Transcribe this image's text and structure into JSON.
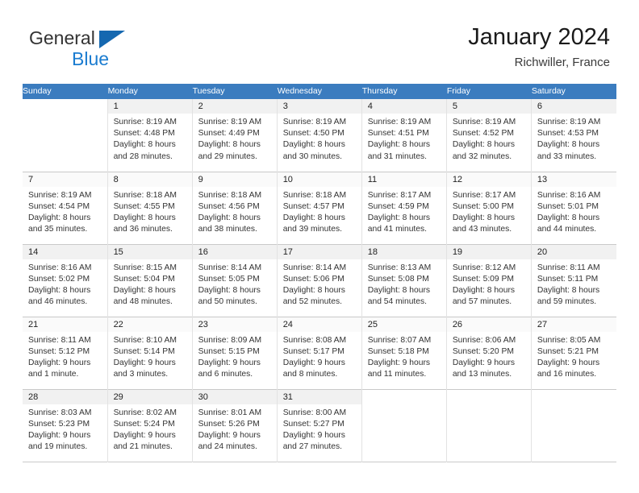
{
  "brand": {
    "word_top": "General",
    "word_bottom": "Blue",
    "triangle_color": "#1568b0",
    "blue_color": "#1b7cd0"
  },
  "header": {
    "title": "January 2024",
    "subtitle": "Richwiller, France"
  },
  "theme": {
    "header_row_background": "#3b7cbf",
    "header_row_text": "#ffffff",
    "daynum_band": "#f1f1f1",
    "grid_line": "#c9c9c9"
  },
  "calendar": {
    "weekday_headers": [
      "Sunday",
      "Monday",
      "Tuesday",
      "Wednesday",
      "Thursday",
      "Friday",
      "Saturday"
    ],
    "labels": {
      "sunrise": "Sunrise:",
      "sunset": "Sunset:",
      "daylight": "Daylight:"
    },
    "weeks": [
      [
        {
          "day": "",
          "lines": []
        },
        {
          "day": "1",
          "lines": [
            "Sunrise: 8:19 AM",
            "Sunset: 4:48 PM",
            "Daylight: 8 hours",
            "and 28 minutes."
          ]
        },
        {
          "day": "2",
          "lines": [
            "Sunrise: 8:19 AM",
            "Sunset: 4:49 PM",
            "Daylight: 8 hours",
            "and 29 minutes."
          ]
        },
        {
          "day": "3",
          "lines": [
            "Sunrise: 8:19 AM",
            "Sunset: 4:50 PM",
            "Daylight: 8 hours",
            "and 30 minutes."
          ]
        },
        {
          "day": "4",
          "lines": [
            "Sunrise: 8:19 AM",
            "Sunset: 4:51 PM",
            "Daylight: 8 hours",
            "and 31 minutes."
          ]
        },
        {
          "day": "5",
          "lines": [
            "Sunrise: 8:19 AM",
            "Sunset: 4:52 PM",
            "Daylight: 8 hours",
            "and 32 minutes."
          ]
        },
        {
          "day": "6",
          "lines": [
            "Sunrise: 8:19 AM",
            "Sunset: 4:53 PM",
            "Daylight: 8 hours",
            "and 33 minutes."
          ]
        }
      ],
      [
        {
          "day": "7",
          "lines": [
            "Sunrise: 8:19 AM",
            "Sunset: 4:54 PM",
            "Daylight: 8 hours",
            "and 35 minutes."
          ]
        },
        {
          "day": "8",
          "lines": [
            "Sunrise: 8:18 AM",
            "Sunset: 4:55 PM",
            "Daylight: 8 hours",
            "and 36 minutes."
          ]
        },
        {
          "day": "9",
          "lines": [
            "Sunrise: 8:18 AM",
            "Sunset: 4:56 PM",
            "Daylight: 8 hours",
            "and 38 minutes."
          ]
        },
        {
          "day": "10",
          "lines": [
            "Sunrise: 8:18 AM",
            "Sunset: 4:57 PM",
            "Daylight: 8 hours",
            "and 39 minutes."
          ]
        },
        {
          "day": "11",
          "lines": [
            "Sunrise: 8:17 AM",
            "Sunset: 4:59 PM",
            "Daylight: 8 hours",
            "and 41 minutes."
          ]
        },
        {
          "day": "12",
          "lines": [
            "Sunrise: 8:17 AM",
            "Sunset: 5:00 PM",
            "Daylight: 8 hours",
            "and 43 minutes."
          ]
        },
        {
          "day": "13",
          "lines": [
            "Sunrise: 8:16 AM",
            "Sunset: 5:01 PM",
            "Daylight: 8 hours",
            "and 44 minutes."
          ]
        }
      ],
      [
        {
          "day": "14",
          "lines": [
            "Sunrise: 8:16 AM",
            "Sunset: 5:02 PM",
            "Daylight: 8 hours",
            "and 46 minutes."
          ]
        },
        {
          "day": "15",
          "lines": [
            "Sunrise: 8:15 AM",
            "Sunset: 5:04 PM",
            "Daylight: 8 hours",
            "and 48 minutes."
          ]
        },
        {
          "day": "16",
          "lines": [
            "Sunrise: 8:14 AM",
            "Sunset: 5:05 PM",
            "Daylight: 8 hours",
            "and 50 minutes."
          ]
        },
        {
          "day": "17",
          "lines": [
            "Sunrise: 8:14 AM",
            "Sunset: 5:06 PM",
            "Daylight: 8 hours",
            "and 52 minutes."
          ]
        },
        {
          "day": "18",
          "lines": [
            "Sunrise: 8:13 AM",
            "Sunset: 5:08 PM",
            "Daylight: 8 hours",
            "and 54 minutes."
          ]
        },
        {
          "day": "19",
          "lines": [
            "Sunrise: 8:12 AM",
            "Sunset: 5:09 PM",
            "Daylight: 8 hours",
            "and 57 minutes."
          ]
        },
        {
          "day": "20",
          "lines": [
            "Sunrise: 8:11 AM",
            "Sunset: 5:11 PM",
            "Daylight: 8 hours",
            "and 59 minutes."
          ]
        }
      ],
      [
        {
          "day": "21",
          "lines": [
            "Sunrise: 8:11 AM",
            "Sunset: 5:12 PM",
            "Daylight: 9 hours",
            "and 1 minute."
          ]
        },
        {
          "day": "22",
          "lines": [
            "Sunrise: 8:10 AM",
            "Sunset: 5:14 PM",
            "Daylight: 9 hours",
            "and 3 minutes."
          ]
        },
        {
          "day": "23",
          "lines": [
            "Sunrise: 8:09 AM",
            "Sunset: 5:15 PM",
            "Daylight: 9 hours",
            "and 6 minutes."
          ]
        },
        {
          "day": "24",
          "lines": [
            "Sunrise: 8:08 AM",
            "Sunset: 5:17 PM",
            "Daylight: 9 hours",
            "and 8 minutes."
          ]
        },
        {
          "day": "25",
          "lines": [
            "Sunrise: 8:07 AM",
            "Sunset: 5:18 PM",
            "Daylight: 9 hours",
            "and 11 minutes."
          ]
        },
        {
          "day": "26",
          "lines": [
            "Sunrise: 8:06 AM",
            "Sunset: 5:20 PM",
            "Daylight: 9 hours",
            "and 13 minutes."
          ]
        },
        {
          "day": "27",
          "lines": [
            "Sunrise: 8:05 AM",
            "Sunset: 5:21 PM",
            "Daylight: 9 hours",
            "and 16 minutes."
          ]
        }
      ],
      [
        {
          "day": "28",
          "lines": [
            "Sunrise: 8:03 AM",
            "Sunset: 5:23 PM",
            "Daylight: 9 hours",
            "and 19 minutes."
          ]
        },
        {
          "day": "29",
          "lines": [
            "Sunrise: 8:02 AM",
            "Sunset: 5:24 PM",
            "Daylight: 9 hours",
            "and 21 minutes."
          ]
        },
        {
          "day": "30",
          "lines": [
            "Sunrise: 8:01 AM",
            "Sunset: 5:26 PM",
            "Daylight: 9 hours",
            "and 24 minutes."
          ]
        },
        {
          "day": "31",
          "lines": [
            "Sunrise: 8:00 AM",
            "Sunset: 5:27 PM",
            "Daylight: 9 hours",
            "and 27 minutes."
          ]
        },
        {
          "day": "",
          "lines": []
        },
        {
          "day": "",
          "lines": []
        },
        {
          "day": "",
          "lines": []
        }
      ]
    ]
  }
}
